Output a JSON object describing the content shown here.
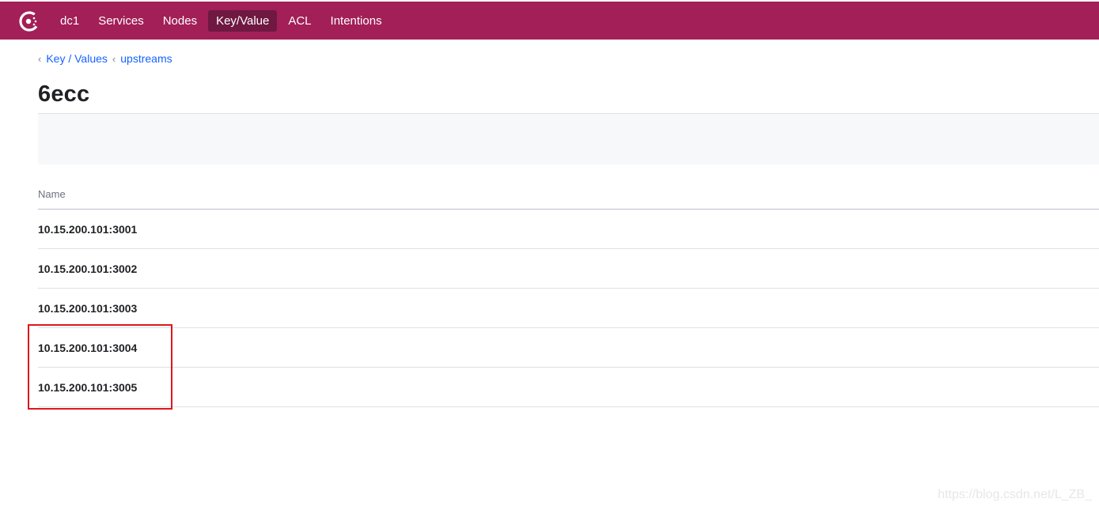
{
  "topbar": {
    "logo_icon": "consul-logo-icon",
    "background_color": "#a21f57",
    "active_color": "#6f1841",
    "nav_items": [
      {
        "label": "dc1"
      },
      {
        "label": "Services"
      },
      {
        "label": "Nodes"
      },
      {
        "label": "Key/Value",
        "active": true
      },
      {
        "label": "ACL"
      },
      {
        "label": "Intentions"
      }
    ]
  },
  "breadcrumb": [
    {
      "label": "Key / Values"
    },
    {
      "label": "upstreams"
    }
  ],
  "page": {
    "title": "6ecc"
  },
  "table": {
    "columns": [
      "Name"
    ],
    "rows": [
      "10.15.200.101:3001",
      "10.15.200.101:3002",
      "10.15.200.101:3003",
      "10.15.200.101:3004",
      "10.15.200.101:3005"
    ]
  },
  "annotation": {
    "highlight_color": "#e0161b"
  },
  "watermark": "https://blog.csdn.net/L_ZB_"
}
